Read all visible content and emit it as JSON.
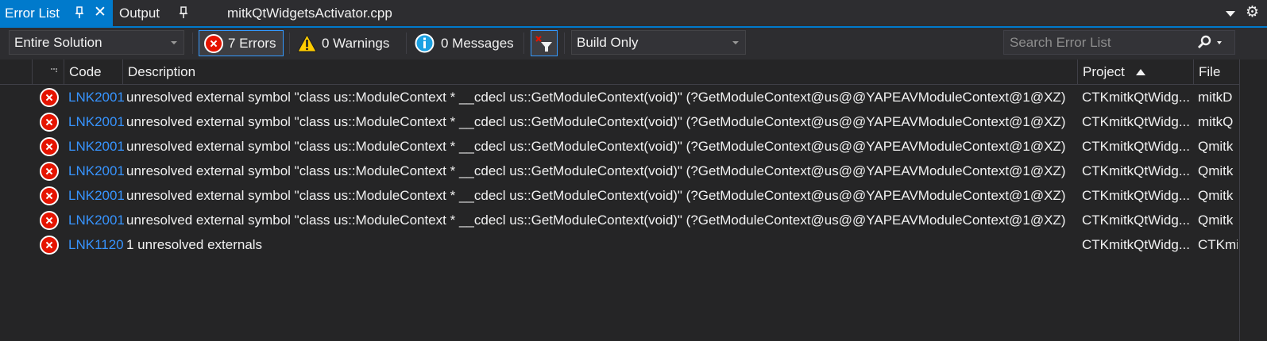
{
  "tabs": {
    "error_list": "Error List",
    "output": "Output",
    "file": "mitkQtWidgetsActivator.cpp"
  },
  "toolbar": {
    "scope": "Entire Solution",
    "errors": "7 Errors",
    "warnings": "0 Warnings",
    "messages": "0 Messages",
    "build_filter": "Build Only",
    "search_placeholder": "Search Error List"
  },
  "columns": {
    "code": "Code",
    "description": "Description",
    "project": "Project",
    "file": "File"
  },
  "rows": [
    {
      "code": "LNK2001",
      "description": "unresolved external symbol \"class us::ModuleContext * __cdecl us::GetModuleContext(void)\" (?GetModuleContext@us@@YAPEAVModuleContext@1@XZ)",
      "project": "CTKmitkQtWidg...",
      "file": "mitkD"
    },
    {
      "code": "LNK2001",
      "description": "unresolved external symbol \"class us::ModuleContext * __cdecl us::GetModuleContext(void)\" (?GetModuleContext@us@@YAPEAVModuleContext@1@XZ)",
      "project": "CTKmitkQtWidg...",
      "file": "mitkQ"
    },
    {
      "code": "LNK2001",
      "description": "unresolved external symbol \"class us::ModuleContext * __cdecl us::GetModuleContext(void)\" (?GetModuleContext@us@@YAPEAVModuleContext@1@XZ)",
      "project": "CTKmitkQtWidg...",
      "file": "Qmitk"
    },
    {
      "code": "LNK2001",
      "description": "unresolved external symbol \"class us::ModuleContext * __cdecl us::GetModuleContext(void)\" (?GetModuleContext@us@@YAPEAVModuleContext@1@XZ)",
      "project": "CTKmitkQtWidg...",
      "file": "Qmitk"
    },
    {
      "code": "LNK2001",
      "description": "unresolved external symbol \"class us::ModuleContext * __cdecl us::GetModuleContext(void)\" (?GetModuleContext@us@@YAPEAVModuleContext@1@XZ)",
      "project": "CTKmitkQtWidg...",
      "file": "Qmitk"
    },
    {
      "code": "LNK2001",
      "description": "unresolved external symbol \"class us::ModuleContext * __cdecl us::GetModuleContext(void)\" (?GetModuleContext@us@@YAPEAVModuleContext@1@XZ)",
      "project": "CTKmitkQtWidg...",
      "file": "Qmitk"
    },
    {
      "code": "LNK1120",
      "description": "1 unresolved externals",
      "project": "CTKmitkQtWidg...",
      "file": "CTKmi"
    }
  ],
  "colors": {
    "accent": "#007acc",
    "error": "#e51400",
    "code_link": "#3794ff",
    "warning": "#ffcc00",
    "info": "#1ba1e2"
  }
}
